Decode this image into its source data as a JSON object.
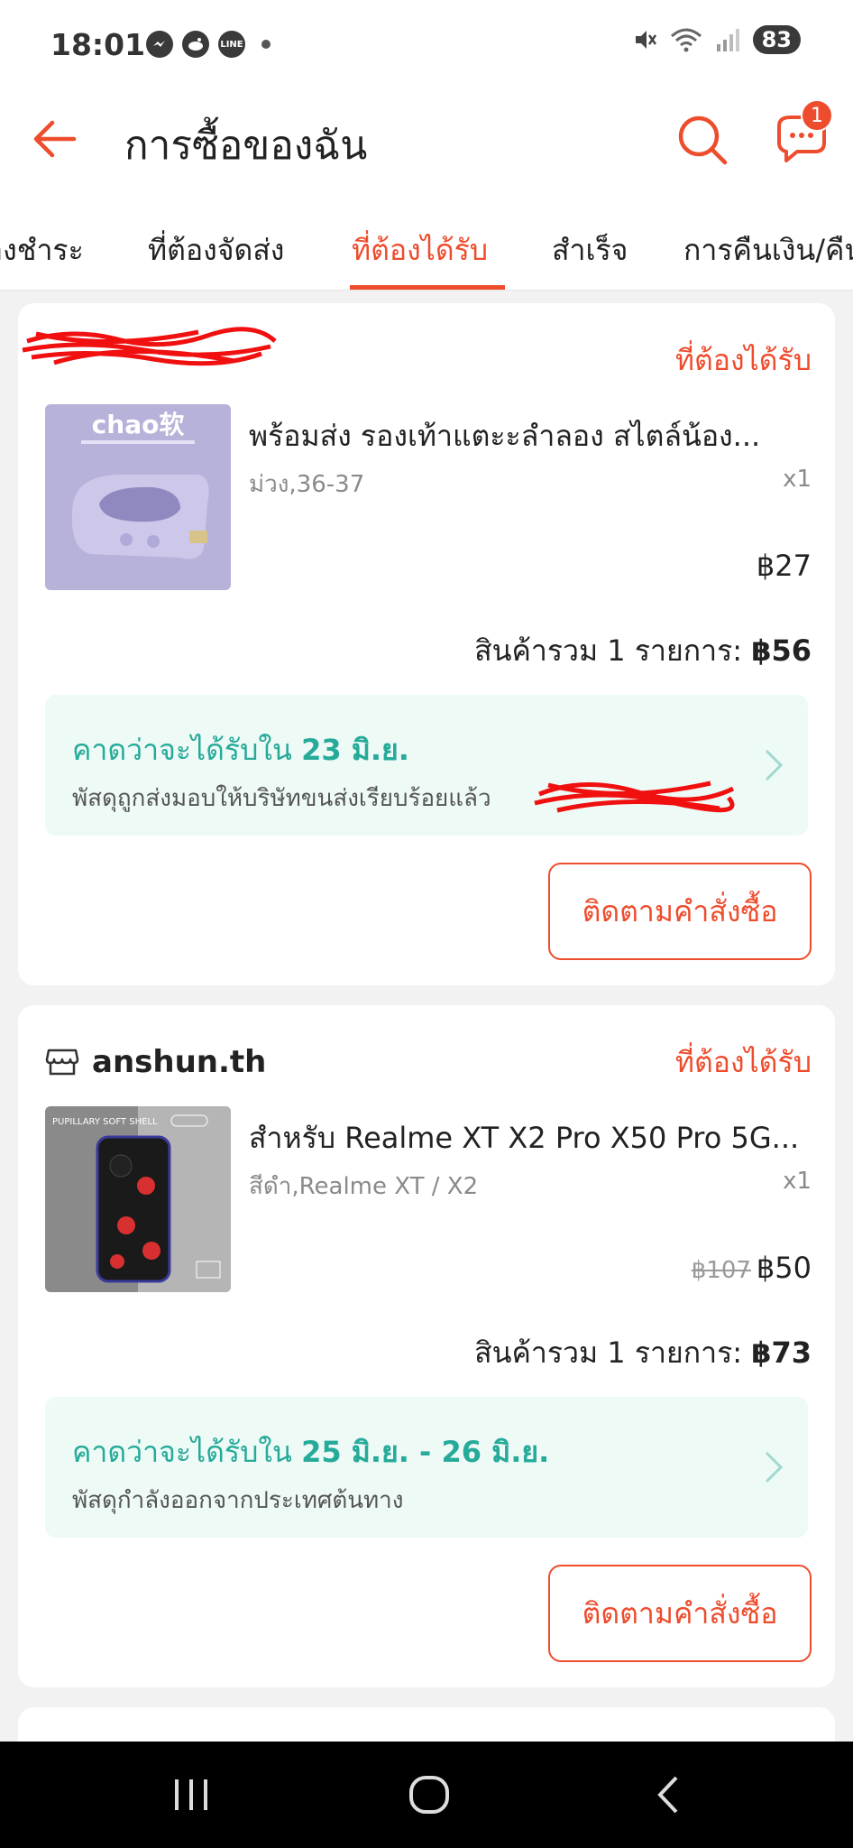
{
  "status_bar": {
    "time": "18:01",
    "battery": "83",
    "app_icons": [
      "messenger-icon",
      "reddit-icon",
      "line-icon"
    ]
  },
  "header": {
    "title": "การซื้อของฉัน",
    "chat_badge": "1"
  },
  "tabs": [
    {
      "label": "ที่ต้องชำระ",
      "active": false
    },
    {
      "label": "ที่ต้องจัดส่ง",
      "active": false
    },
    {
      "label": "ที่ต้องได้รับ",
      "active": true
    },
    {
      "label": "สำเร็จ",
      "active": false
    },
    {
      "label": "การคืนเงิน/คืนสินค้า",
      "active": false
    }
  ],
  "orders": [
    {
      "shop_name": "",
      "status": "ที่ต้องได้รับ",
      "product_title": "พร้อมส่ง รองเท้าแตะะลําลอง สไตล์น้อง...",
      "variant": "ม่วง,36-37",
      "quantity": "x1",
      "original_price": "",
      "price": "฿27",
      "total_label": "สินค้ารวม 1 รายการ:",
      "total_value": "฿56",
      "eta_prefix": "คาดว่าจะได้รับใน",
      "eta_date": "23 มิ.ย.",
      "eta_note": "พัสดุถูกส่งมอบให้บริษัทขนส่งเรียบร้อยแล้ว",
      "image_text": "chao软",
      "button_label": "ติดตามคำสั่งซื้อ"
    },
    {
      "shop_name": "anshun.th",
      "status": "ที่ต้องได้รับ",
      "product_title": "สำหรับ Realme XT X2 Pro X50 Pro 5G...",
      "variant": "สีดำ,Realme XT / X2",
      "quantity": "x1",
      "original_price": "฿107",
      "price": "฿50",
      "total_label": "สินค้ารวม 1 รายการ:",
      "total_value": "฿73",
      "eta_prefix": "คาดว่าจะได้รับใน",
      "eta_date": "25 มิ.ย. - 26 มิ.ย.",
      "eta_note": "พัสดุกำลังออกจากประเทศต้นทาง",
      "image_text": "PUPILLARY SOFT SHELL",
      "button_label": "ติดตามคำสั่งซื้อ"
    }
  ],
  "colors": {
    "accent": "#ee4d2d",
    "eta_green": "#26aa99",
    "eta_bg": "#eefaf6"
  }
}
